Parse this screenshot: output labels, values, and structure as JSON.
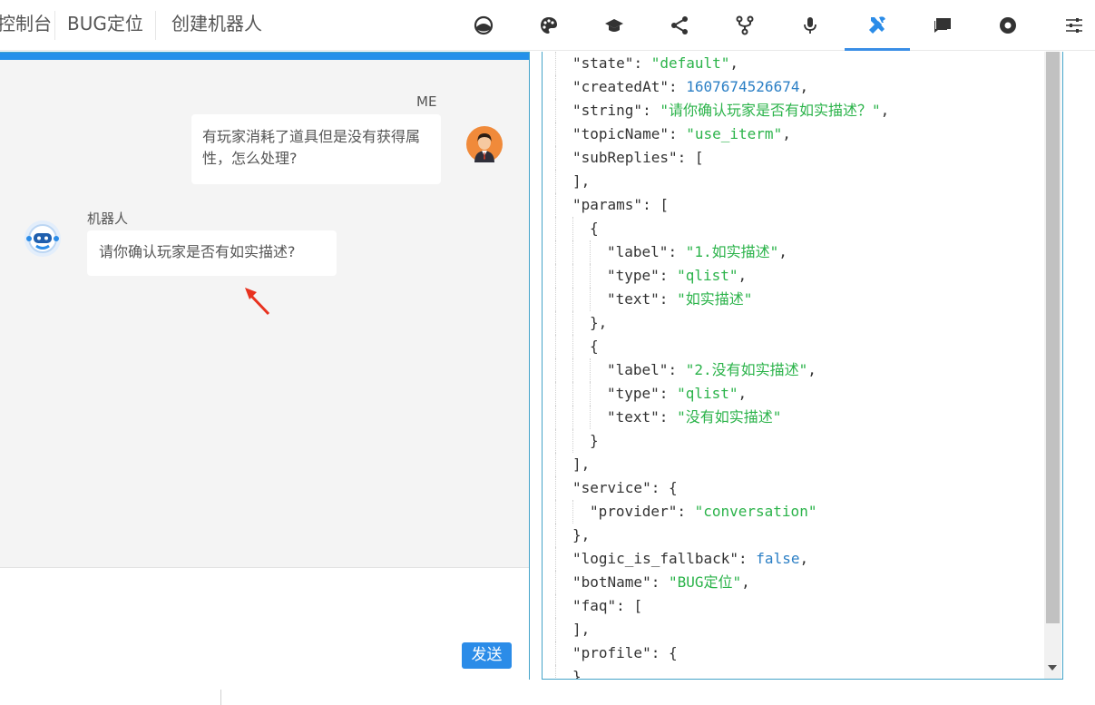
{
  "nav": {
    "console": "控制台",
    "bug_locate": "BUG定位",
    "create_robot": "创建机器人"
  },
  "toolbar_icons": [
    "dashboard-icon",
    "palette-icon",
    "graduation-cap-icon",
    "share-icon",
    "branch-icon",
    "microphone-icon",
    "tools-icon",
    "chat-icon",
    "target-icon",
    "sliders-icon"
  ],
  "active_tool": "tools-icon",
  "chat": {
    "me_name": "ME",
    "me_message": "有玩家消耗了道具但是没有获得属性，怎么处理?",
    "bot_name": "机器人",
    "bot_message": "请你确认玩家是否有如实描述?",
    "send_label": "发送"
  },
  "json_view": {
    "lines": [
      {
        "indent": 1,
        "key": "\"state\"",
        "value": "\"default\"",
        "vtype": "s",
        "tail": ","
      },
      {
        "indent": 1,
        "key": "\"createdAt\"",
        "value": "1607674526674",
        "vtype": "n",
        "tail": ","
      },
      {
        "indent": 1,
        "key": "\"string\"",
        "value": "\"请你确认玩家是否有如实描述？\"",
        "vtype": "s",
        "tail": ","
      },
      {
        "indent": 1,
        "key": "\"topicName\"",
        "value": "\"use_iterm\"",
        "vtype": "s",
        "tail": ","
      },
      {
        "indent": 1,
        "key": "\"subReplies\"",
        "value": "[",
        "vtype": "p",
        "tail": ""
      },
      {
        "indent": 1,
        "key": "",
        "value": "],",
        "vtype": "p",
        "tail": ""
      },
      {
        "indent": 1,
        "key": "\"params\"",
        "value": "[",
        "vtype": "p",
        "tail": ""
      },
      {
        "indent": 2,
        "key": "",
        "value": "{",
        "vtype": "p",
        "tail": ""
      },
      {
        "indent": 3,
        "key": "\"label\"",
        "value": "\"1.如实描述\"",
        "vtype": "s",
        "tail": ","
      },
      {
        "indent": 3,
        "key": "\"type\"",
        "value": "\"qlist\"",
        "vtype": "s",
        "tail": ","
      },
      {
        "indent": 3,
        "key": "\"text\"",
        "value": "\"如实描述\"",
        "vtype": "s",
        "tail": ""
      },
      {
        "indent": 2,
        "key": "",
        "value": "},",
        "vtype": "p",
        "tail": ""
      },
      {
        "indent": 2,
        "key": "",
        "value": "{",
        "vtype": "p",
        "tail": ""
      },
      {
        "indent": 3,
        "key": "\"label\"",
        "value": "\"2.没有如实描述\"",
        "vtype": "s",
        "tail": ","
      },
      {
        "indent": 3,
        "key": "\"type\"",
        "value": "\"qlist\"",
        "vtype": "s",
        "tail": ","
      },
      {
        "indent": 3,
        "key": "\"text\"",
        "value": "\"没有如实描述\"",
        "vtype": "s",
        "tail": ""
      },
      {
        "indent": 2,
        "key": "",
        "value": "}",
        "vtype": "p",
        "tail": ""
      },
      {
        "indent": 1,
        "key": "",
        "value": "],",
        "vtype": "p",
        "tail": ""
      },
      {
        "indent": 1,
        "key": "\"service\"",
        "value": "{",
        "vtype": "p",
        "tail": ""
      },
      {
        "indent": 2,
        "key": "\"provider\"",
        "value": "\"conversation\"",
        "vtype": "s",
        "tail": ""
      },
      {
        "indent": 1,
        "key": "",
        "value": "},",
        "vtype": "p",
        "tail": ""
      },
      {
        "indent": 1,
        "key": "\"logic_is_fallback\"",
        "value": "false",
        "vtype": "n",
        "tail": ","
      },
      {
        "indent": 1,
        "key": "\"botName\"",
        "value": "\"BUG定位\"",
        "vtype": "s",
        "tail": ","
      },
      {
        "indent": 1,
        "key": "\"faq\"",
        "value": "[",
        "vtype": "p",
        "tail": ""
      },
      {
        "indent": 1,
        "key": "",
        "value": "],",
        "vtype": "p",
        "tail": ""
      },
      {
        "indent": 1,
        "key": "\"profile\"",
        "value": "{",
        "vtype": "p",
        "tail": ""
      },
      {
        "indent": 1,
        "key": "",
        "value": "}",
        "vtype": "p",
        "tail": ""
      }
    ]
  },
  "colors": {
    "accent": "#2b8ce8",
    "json_string": "#2bb34a",
    "json_number": "#2b7fc5",
    "panel_border": "#45a4c9",
    "annotation_arrow": "#e8321f"
  }
}
